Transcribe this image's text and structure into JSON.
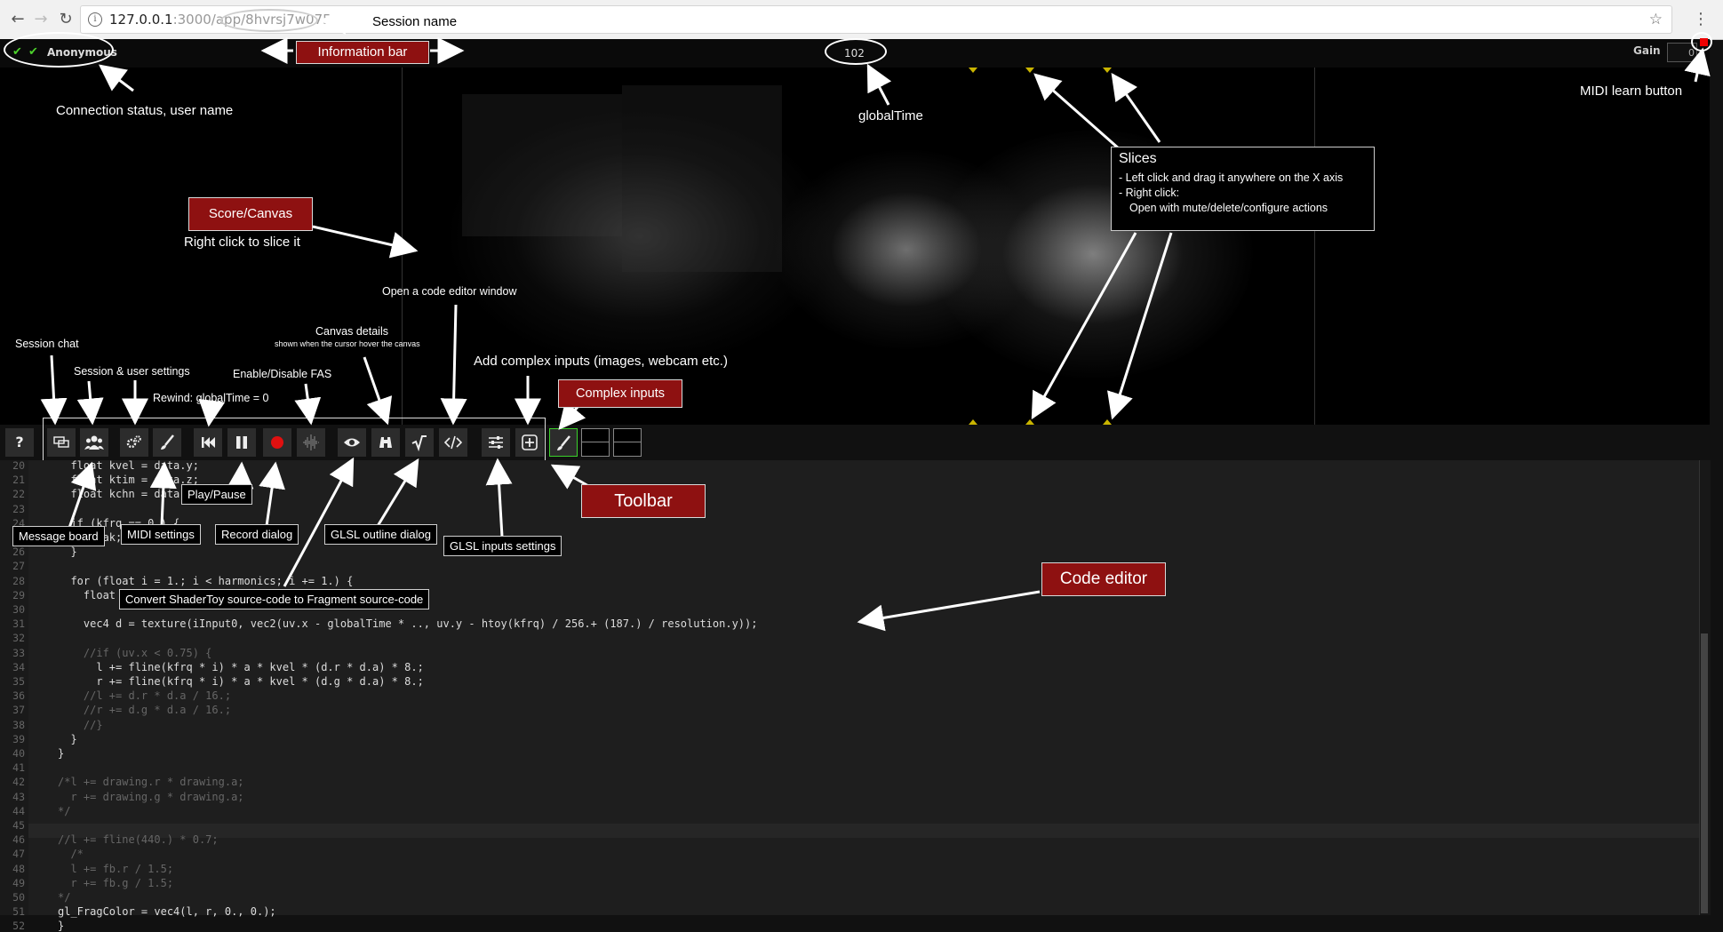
{
  "browser": {
    "url_host": "127.0.0.1",
    "url_path": ":3000/app/8hvrsj7w075"
  },
  "infobar": {
    "username": "Anonymous",
    "global_time": "102",
    "gain_label": "Gain",
    "gain_value": "0"
  },
  "toolbar": {
    "help": "?"
  },
  "editor": {
    "lines": [
      {
        "n": "20",
        "code": "  float kvel = data.y;",
        "comment": false
      },
      {
        "n": "21",
        "code": "  float ktim = data.z;",
        "comment": false
      },
      {
        "n": "22",
        "code": "  float kchn = data.w;",
        "comment": false
      },
      {
        "n": "23",
        "code": "",
        "comment": false
      },
      {
        "n": "24",
        "code": "  if (kfrq == 0.) {",
        "comment": false
      },
      {
        "n": "25",
        "code": "    break;",
        "comment": false
      },
      {
        "n": "26",
        "code": "  }",
        "comment": false
      },
      {
        "n": "27",
        "code": "",
        "comment": false
      },
      {
        "n": "28",
        "code": "  for (float i = 1.; i < harmonics; i += 1.) {",
        "comment": false
      },
      {
        "n": "29",
        "code": "    float a = 1. / pow(i, attenuation_constant);",
        "comment": false
      },
      {
        "n": "30",
        "code": "",
        "comment": false
      },
      {
        "n": "31",
        "code": "    vec4 d = texture(iInput0, vec2(uv.x - globalTime * .., uv.y - htoy(kfrq) / 256.+ (187.) / resolution.y));",
        "comment": false
      },
      {
        "n": "32",
        "code": "",
        "comment": false
      },
      {
        "n": "33",
        "code": "    //if (uv.x < 0.75) {",
        "comment": true
      },
      {
        "n": "34",
        "code": "      l += fline(kfrq * i) * a * kvel * (d.r * d.a) * 8.;",
        "comment": false
      },
      {
        "n": "35",
        "code": "      r += fline(kfrq * i) * a * kvel * (d.g * d.a) * 8.;",
        "comment": false
      },
      {
        "n": "36",
        "code": "    //l += d.r * d.a / 16.;",
        "comment": true
      },
      {
        "n": "37",
        "code": "    //r += d.g * d.a / 16.;",
        "comment": true
      },
      {
        "n": "38",
        "code": "    //}",
        "comment": true
      },
      {
        "n": "39",
        "code": "  }",
        "comment": false
      },
      {
        "n": "40",
        "code": "}",
        "comment": false
      },
      {
        "n": "41",
        "code": "",
        "comment": false
      },
      {
        "n": "42",
        "code": "/*l += drawing.r * drawing.a;",
        "comment": true
      },
      {
        "n": "43",
        "code": "  r += drawing.g * drawing.a;",
        "comment": true
      },
      {
        "n": "44",
        "code": "*/",
        "comment": true
      },
      {
        "n": "45",
        "code": "",
        "comment": false
      },
      {
        "n": "46",
        "code": "//l += fline(440.) * 0.7;",
        "comment": true
      },
      {
        "n": "47",
        "code": "  /*",
        "comment": true
      },
      {
        "n": "48",
        "code": "  l += fb.r / 1.5;",
        "comment": true
      },
      {
        "n": "49",
        "code": "  r += fb.g / 1.5;",
        "comment": true
      },
      {
        "n": "50",
        "code": "*/",
        "comment": true
      },
      {
        "n": "51",
        "code": "gl_FragColor = vec4(l, r, 0., 0.);",
        "comment": false
      },
      {
        "n": "52",
        "code": "}",
        "comment": false
      }
    ]
  },
  "annotations": {
    "session_name": "Session name",
    "information_bar": "Information bar",
    "connection_status": "Connection status, user name",
    "global_time": "globalTime",
    "midi_learn": "MIDI learn button",
    "slices_title": "Slices",
    "slices_line1": "- Left click and drag it anywhere on the X axis",
    "slices_line2": "- Right click:",
    "slices_line3": "Open with mute/delete/configure actions",
    "score_canvas": "Score/Canvas",
    "right_click_slice": "Right click to slice it",
    "open_code_editor": "Open a code editor window",
    "canvas_details": "Canvas details",
    "canvas_details_sub": "shown when the cursor hover the canvas",
    "add_complex_inputs": "Add complex inputs (images, webcam etc.)",
    "complex_inputs": "Complex inputs",
    "session_chat": "Session chat",
    "session_user_settings": "Session & user settings",
    "enable_disable_fas": "Enable/Disable FAS",
    "rewind": "Rewind: globalTime = 0",
    "play_pause": "Play/Pause",
    "message_board": "Message board",
    "midi_settings": "MIDI settings",
    "record_dialog": "Record dialog",
    "glsl_outline": "GLSL outline dialog",
    "glsl_inputs": "GLSL inputs settings",
    "convert_shadertoy": "Convert ShaderToy source-code to Fragment source-code",
    "toolbar": "Toolbar",
    "code_editor": "Code editor"
  }
}
